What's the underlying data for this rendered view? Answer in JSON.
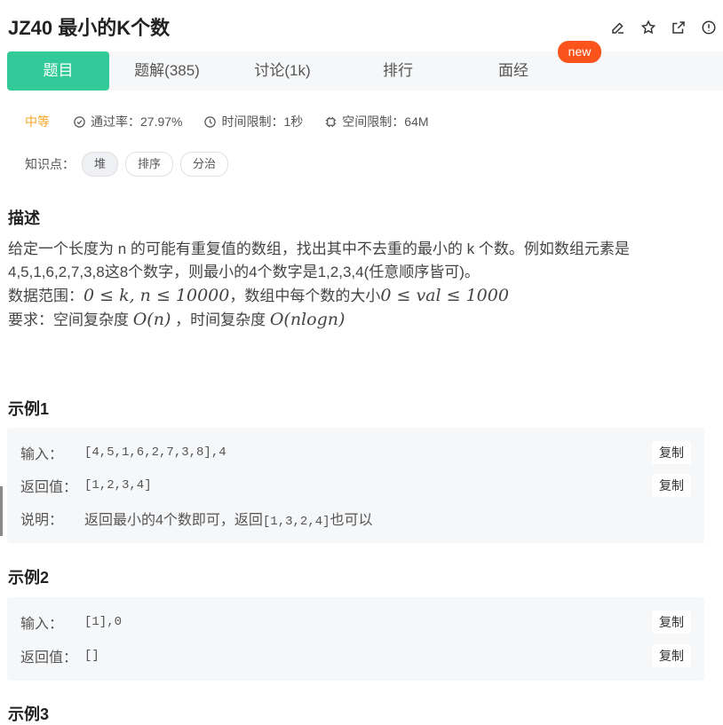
{
  "title": "JZ40  最小的K个数",
  "tabs": [
    {
      "label": "题目"
    },
    {
      "label": "题解(385)"
    },
    {
      "label": "讨论(1k)"
    },
    {
      "label": "排行"
    },
    {
      "label": "面经"
    }
  ],
  "new_badge": "new",
  "meta": {
    "difficulty": "中等",
    "pass_rate": "通过率：27.97%",
    "time_limit": "时间限制：1秒",
    "memory_limit": "空间限制：64M"
  },
  "tags": {
    "label": "知识点：",
    "items": [
      "堆",
      "排序",
      "分治"
    ]
  },
  "description": {
    "heading": "描述",
    "line1": "给定一个长度为 n 的可能有重复值的数组，找出其中不去重的最小的 k 个数。例如数组元素是4,5,1,6,2,7,3,8这8个数字，则最小的4个数字是1,2,3,4(任意顺序皆可)。",
    "range_prefix": "数据范围：",
    "range_math1": "0 ≤ k, n ≤ 10000",
    "range_mid": "，数组中每个数的大小",
    "range_math2": "0 ≤ val ≤ 1000",
    "req_prefix": "要求：空间复杂度 ",
    "req_math1": "O(n)",
    "req_mid": " ，时间复杂度 ",
    "req_math2": "O(nlogn)"
  },
  "examples": [
    {
      "heading": "示例1",
      "input_label": "输入：",
      "input": "[4,5,1,6,2,7,3,8],4",
      "output_label": "返回值：",
      "output": "[1,2,3,4]",
      "note_label": "说明：",
      "note_pre": "返回最小的4个数即可，返回",
      "note_code": "[1,3,2,4]",
      "note_post": "也可以"
    },
    {
      "heading": "示例2",
      "input_label": "输入：",
      "input": "[1],0",
      "output_label": "返回值：",
      "output": "[]"
    },
    {
      "heading": "示例3"
    }
  ],
  "copy_label": "复制"
}
